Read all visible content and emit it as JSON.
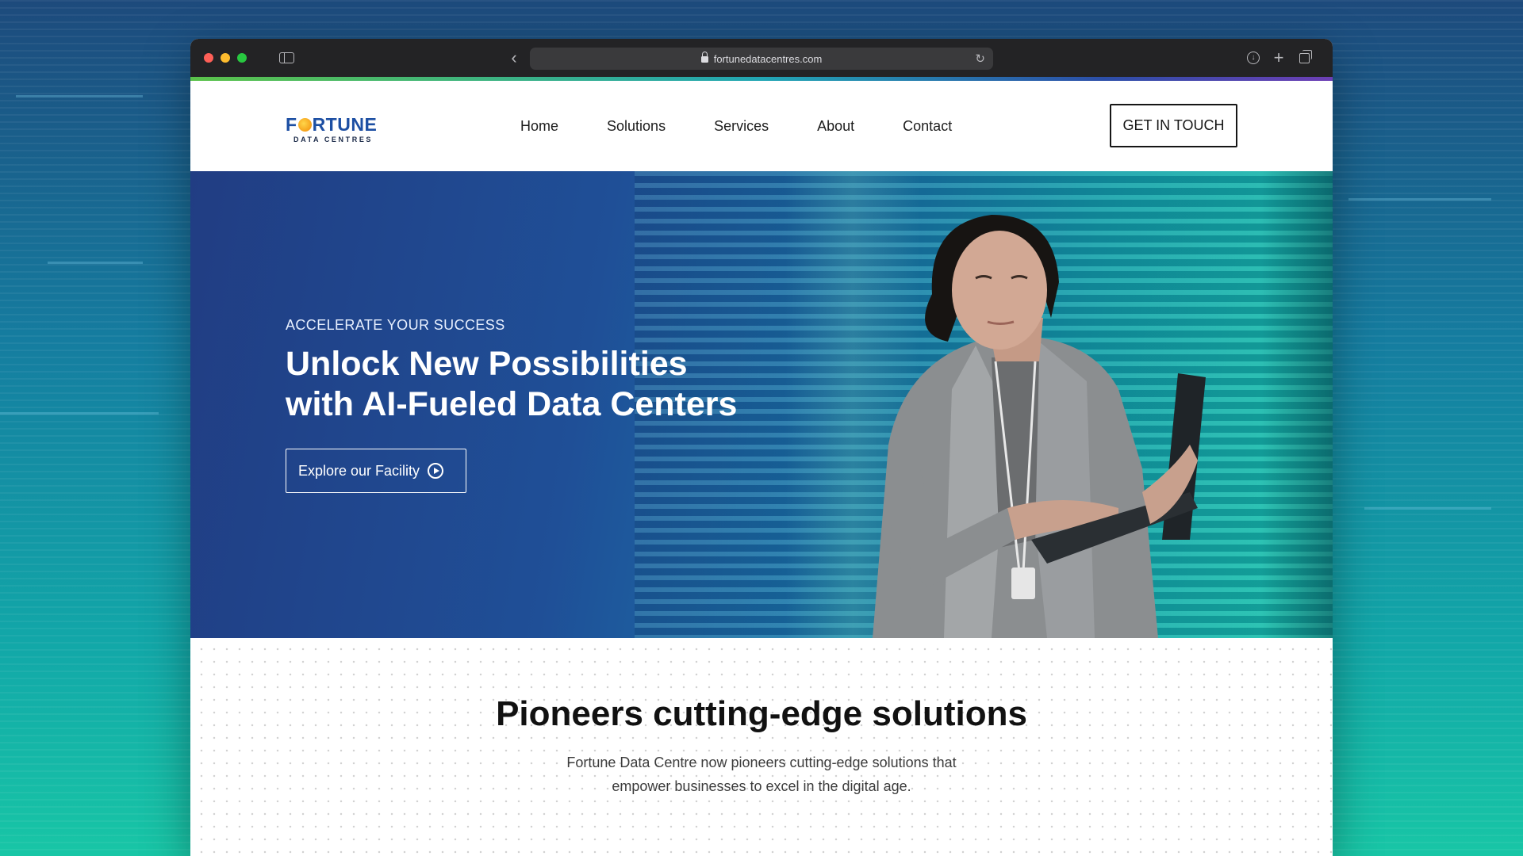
{
  "browser": {
    "url": "fortunedatacentres.com",
    "icons": [
      "sidebar-toggle-icon",
      "back-icon",
      "forward-icon",
      "shield-icon",
      "lock-icon",
      "reload-icon",
      "download-icon",
      "new-tab-icon",
      "tabs-overview-icon"
    ]
  },
  "header": {
    "logo_word_start": "F",
    "logo_word_end": "RTUNE",
    "logo_sub": "DATA CENTRES",
    "nav": [
      "Home",
      "Solutions",
      "Services",
      "About",
      "Contact"
    ],
    "cta_label": "GET IN TOUCH"
  },
  "hero": {
    "eyebrow": "ACCELERATE YOUR SUCCESS",
    "title_line1": "Unlock New Possibilities",
    "title_line2": "with AI-Fueled Data Centers",
    "button_label": "Explore our Facility",
    "button_icon": "play-circle-icon"
  },
  "section": {
    "title": "Pioneers cutting-edge solutions",
    "text": "Fortune Data Centre now pioneers cutting-edge solutions that empower businesses to excel in the digital age."
  },
  "colors": {
    "brand_blue": "#1d4fa3",
    "brand_orange": "#f6a11a",
    "hero_start": "#213d83",
    "hero_end": "#18c2aa"
  }
}
